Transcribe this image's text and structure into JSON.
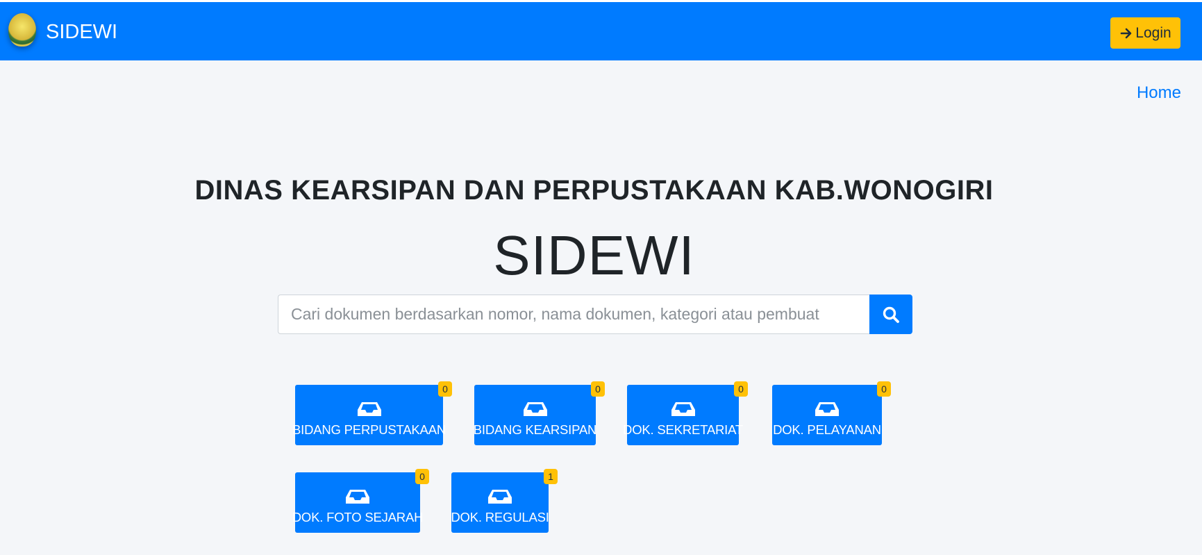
{
  "header": {
    "brand": "SIDEWI",
    "login_label": "Login"
  },
  "nav": {
    "home_label": "Home"
  },
  "hero": {
    "title": "DINAS KEARSIPAN DAN PERPUSTAKAAN KAB.WONOGIRI",
    "subtitle": "SIDEWI"
  },
  "search": {
    "placeholder": "Cari dokumen berdasarkan nomor, nama dokumen, kategori atau pembuat",
    "value": ""
  },
  "categories": [
    {
      "label": "BIDANG PERPUSTAKAAN",
      "count": "0"
    },
    {
      "label": "BIDANG KEARSIPAN",
      "count": "0"
    },
    {
      "label": "DOK. SEKRETARIAT",
      "count": "0"
    },
    {
      "label": "DOK. PELAYANAN",
      "count": "0"
    },
    {
      "label": "DOK. FOTO SEJARAH",
      "count": "0"
    },
    {
      "label": "DOK. REGULASI",
      "count": "1"
    }
  ],
  "colors": {
    "primary": "#007bff",
    "warning": "#ffc107",
    "background": "#f4f6f9",
    "text_dark": "#1f2428"
  },
  "icons": {
    "login": "sign-in-arrow-icon",
    "search": "search-icon",
    "category": "inbox-tray-icon"
  }
}
